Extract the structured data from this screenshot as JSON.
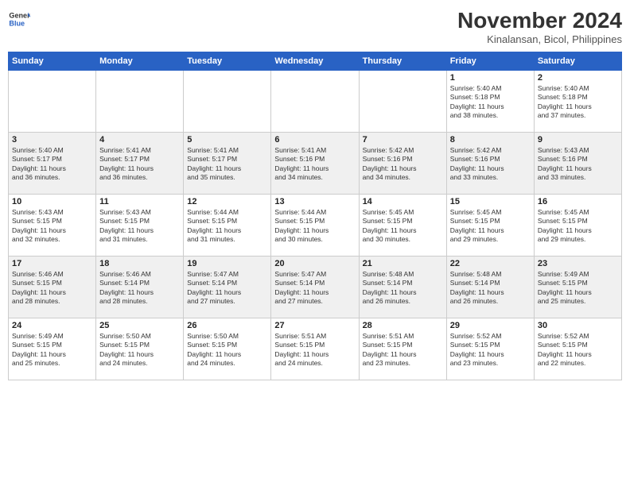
{
  "header": {
    "logo_line1": "General",
    "logo_line2": "Blue",
    "month": "November 2024",
    "location": "Kinalansan, Bicol, Philippines"
  },
  "weekdays": [
    "Sunday",
    "Monday",
    "Tuesday",
    "Wednesday",
    "Thursday",
    "Friday",
    "Saturday"
  ],
  "weeks": [
    [
      {
        "day": "",
        "info": ""
      },
      {
        "day": "",
        "info": ""
      },
      {
        "day": "",
        "info": ""
      },
      {
        "day": "",
        "info": ""
      },
      {
        "day": "",
        "info": ""
      },
      {
        "day": "1",
        "info": "Sunrise: 5:40 AM\nSunset: 5:18 PM\nDaylight: 11 hours\nand 38 minutes."
      },
      {
        "day": "2",
        "info": "Sunrise: 5:40 AM\nSunset: 5:18 PM\nDaylight: 11 hours\nand 37 minutes."
      }
    ],
    [
      {
        "day": "3",
        "info": "Sunrise: 5:40 AM\nSunset: 5:17 PM\nDaylight: 11 hours\nand 36 minutes."
      },
      {
        "day": "4",
        "info": "Sunrise: 5:41 AM\nSunset: 5:17 PM\nDaylight: 11 hours\nand 36 minutes."
      },
      {
        "day": "5",
        "info": "Sunrise: 5:41 AM\nSunset: 5:17 PM\nDaylight: 11 hours\nand 35 minutes."
      },
      {
        "day": "6",
        "info": "Sunrise: 5:41 AM\nSunset: 5:16 PM\nDaylight: 11 hours\nand 34 minutes."
      },
      {
        "day": "7",
        "info": "Sunrise: 5:42 AM\nSunset: 5:16 PM\nDaylight: 11 hours\nand 34 minutes."
      },
      {
        "day": "8",
        "info": "Sunrise: 5:42 AM\nSunset: 5:16 PM\nDaylight: 11 hours\nand 33 minutes."
      },
      {
        "day": "9",
        "info": "Sunrise: 5:43 AM\nSunset: 5:16 PM\nDaylight: 11 hours\nand 33 minutes."
      }
    ],
    [
      {
        "day": "10",
        "info": "Sunrise: 5:43 AM\nSunset: 5:15 PM\nDaylight: 11 hours\nand 32 minutes."
      },
      {
        "day": "11",
        "info": "Sunrise: 5:43 AM\nSunset: 5:15 PM\nDaylight: 11 hours\nand 31 minutes."
      },
      {
        "day": "12",
        "info": "Sunrise: 5:44 AM\nSunset: 5:15 PM\nDaylight: 11 hours\nand 31 minutes."
      },
      {
        "day": "13",
        "info": "Sunrise: 5:44 AM\nSunset: 5:15 PM\nDaylight: 11 hours\nand 30 minutes."
      },
      {
        "day": "14",
        "info": "Sunrise: 5:45 AM\nSunset: 5:15 PM\nDaylight: 11 hours\nand 30 minutes."
      },
      {
        "day": "15",
        "info": "Sunrise: 5:45 AM\nSunset: 5:15 PM\nDaylight: 11 hours\nand 29 minutes."
      },
      {
        "day": "16",
        "info": "Sunrise: 5:45 AM\nSunset: 5:15 PM\nDaylight: 11 hours\nand 29 minutes."
      }
    ],
    [
      {
        "day": "17",
        "info": "Sunrise: 5:46 AM\nSunset: 5:15 PM\nDaylight: 11 hours\nand 28 minutes."
      },
      {
        "day": "18",
        "info": "Sunrise: 5:46 AM\nSunset: 5:14 PM\nDaylight: 11 hours\nand 28 minutes."
      },
      {
        "day": "19",
        "info": "Sunrise: 5:47 AM\nSunset: 5:14 PM\nDaylight: 11 hours\nand 27 minutes."
      },
      {
        "day": "20",
        "info": "Sunrise: 5:47 AM\nSunset: 5:14 PM\nDaylight: 11 hours\nand 27 minutes."
      },
      {
        "day": "21",
        "info": "Sunrise: 5:48 AM\nSunset: 5:14 PM\nDaylight: 11 hours\nand 26 minutes."
      },
      {
        "day": "22",
        "info": "Sunrise: 5:48 AM\nSunset: 5:14 PM\nDaylight: 11 hours\nand 26 minutes."
      },
      {
        "day": "23",
        "info": "Sunrise: 5:49 AM\nSunset: 5:15 PM\nDaylight: 11 hours\nand 25 minutes."
      }
    ],
    [
      {
        "day": "24",
        "info": "Sunrise: 5:49 AM\nSunset: 5:15 PM\nDaylight: 11 hours\nand 25 minutes."
      },
      {
        "day": "25",
        "info": "Sunrise: 5:50 AM\nSunset: 5:15 PM\nDaylight: 11 hours\nand 24 minutes."
      },
      {
        "day": "26",
        "info": "Sunrise: 5:50 AM\nSunset: 5:15 PM\nDaylight: 11 hours\nand 24 minutes."
      },
      {
        "day": "27",
        "info": "Sunrise: 5:51 AM\nSunset: 5:15 PM\nDaylight: 11 hours\nand 24 minutes."
      },
      {
        "day": "28",
        "info": "Sunrise: 5:51 AM\nSunset: 5:15 PM\nDaylight: 11 hours\nand 23 minutes."
      },
      {
        "day": "29",
        "info": "Sunrise: 5:52 AM\nSunset: 5:15 PM\nDaylight: 11 hours\nand 23 minutes."
      },
      {
        "day": "30",
        "info": "Sunrise: 5:52 AM\nSunset: 5:15 PM\nDaylight: 11 hours\nand 22 minutes."
      }
    ]
  ]
}
